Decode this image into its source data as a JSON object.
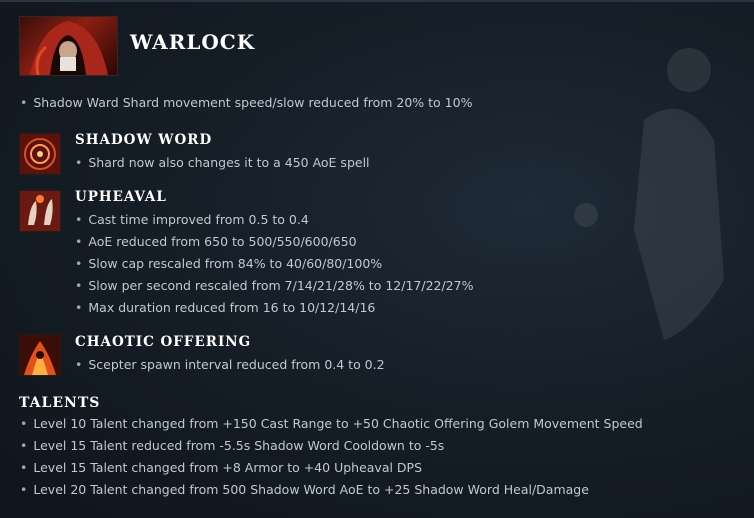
{
  "hero": {
    "name": "WARLOCK",
    "notes": [
      "Shadow Ward Shard movement speed/slow reduced from 20% to 10%"
    ]
  },
  "abilities": [
    {
      "name": "SHADOW WORD",
      "icon": "shadow-word-icon",
      "notes": [
        "Shard now also changes it to a 450 AoE spell"
      ]
    },
    {
      "name": "UPHEAVAL",
      "icon": "upheaval-icon",
      "notes": [
        "Cast time improved from 0.5 to 0.4",
        "AoE reduced from 650 to 500/550/600/650",
        "Slow cap rescaled from 84% to 40/60/80/100%",
        "Slow per second rescaled from 7/14/21/28% to 12/17/22/27%",
        "Max duration reduced from 16 to 10/12/14/16"
      ]
    },
    {
      "name": "CHAOTIC OFFERING",
      "icon": "chaotic-offering-icon",
      "notes": [
        "Scepter spawn interval reduced from 0.4 to 0.2"
      ]
    }
  ],
  "talents": {
    "title": "TALENTS",
    "notes": [
      "Level 10 Talent changed from +150 Cast Range to +50 Chaotic Offering Golem Movement Speed",
      "Level 15 Talent reduced from -5.5s Shadow Word Cooldown to -5s",
      "Level 15 Talent changed from +8 Armor to +40 Upheaval DPS",
      "Level 20 Talent changed from 500 Shadow Word AoE to +25 Shadow Word Heal/Damage"
    ]
  },
  "colors": {
    "background": "#141c25",
    "heading": "#ffffff",
    "body_text": "#c0c8d0"
  }
}
